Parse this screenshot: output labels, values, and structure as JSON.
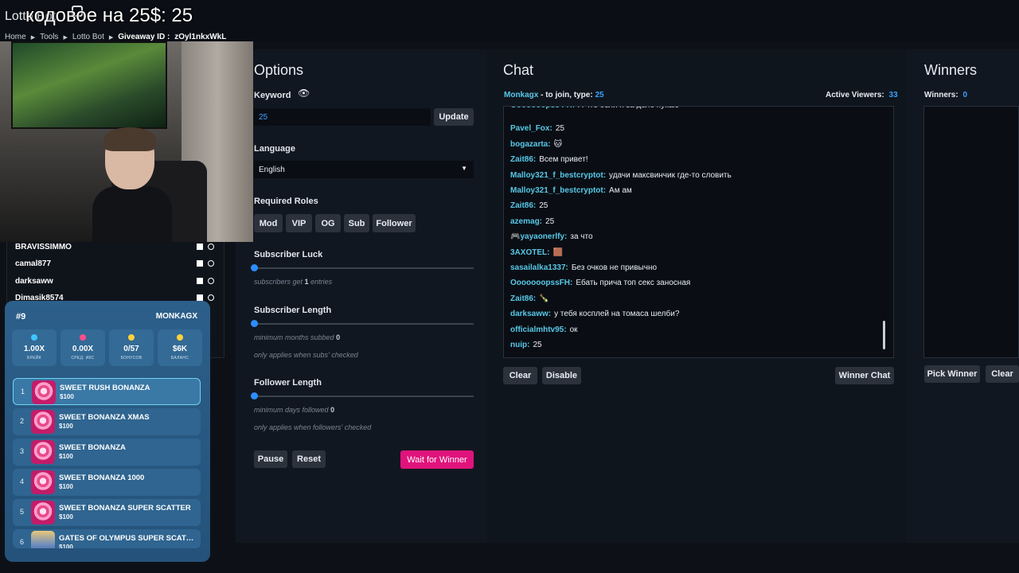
{
  "header": {
    "app_title": "Lotto Bot",
    "overlay_text": "кодовое на 25$: 25",
    "breadcrumb": [
      "Home",
      "Tools",
      "Lotto Bot"
    ],
    "giveaway_id_label": "Giveaway ID :",
    "giveaway_id": "zOyl1nkxWkL"
  },
  "options": {
    "title": "Options",
    "keyword_label": "Keyword",
    "keyword_value": "25",
    "update_label": "Update",
    "language_label": "Language",
    "language_value": "English",
    "roles_label": "Required Roles",
    "roles": [
      "Mod",
      "VIP",
      "OG",
      "Sub",
      "Follower"
    ],
    "sub_luck_label": "Subscriber Luck",
    "sub_luck_hint_pre": "subscribers get",
    "sub_luck_value": "1",
    "sub_luck_hint_post": "entries",
    "sub_length_label": "Subscriber Length",
    "sub_length_hint": "minimum months subbed",
    "sub_length_value": "0",
    "sub_length_note": "only applies when subs' checked",
    "follower_length_label": "Follower Length",
    "follower_length_hint": "minimum days followed",
    "follower_length_value": "0",
    "follower_length_note": "only applies when followers' checked",
    "pause_label": "Pause",
    "reset_label": "Reset",
    "wait_label": "Wait for Winner",
    "slider_levels": [
      0,
      0,
      0
    ]
  },
  "chat": {
    "title": "Chat",
    "join_user": "Monkagx",
    "join_text": " - to join, type: ",
    "join_keyword": "25",
    "active_label": "Active Viewers:",
    "active_count": "33",
    "messages": [
      {
        "user": "Ooooooopss FH:",
        "text": "А что если я за дело пукаю"
      },
      {
        "user": "Pavel_Fox:",
        "text": "25"
      },
      {
        "user": "bogazarta:",
        "text": "🐱"
      },
      {
        "user": "Zait86:",
        "text": "Всем привет!"
      },
      {
        "user": "Malloy321_f_bestcryptot:",
        "text": "удачи максвинчик где-то словить"
      },
      {
        "user": "Malloy321_f_bestcryptot:",
        "text": "Ам ам"
      },
      {
        "user": "Zait86:",
        "text": "25"
      },
      {
        "user": "azemag:",
        "text": "25"
      },
      {
        "user": "🎮yayaonerlfy:",
        "text": "за что"
      },
      {
        "user": "3AXOTEL:",
        "text": "🟫"
      },
      {
        "user": "sasailalka1337:",
        "text": "Без очков не привычно"
      },
      {
        "user": "OoooooopssFH:",
        "text": "Ебать прича топ секс заносная"
      },
      {
        "user": "Zait86:",
        "text": "🍾"
      },
      {
        "user": "darksaww:",
        "text": "у тебя косплей на томаса шелби?"
      },
      {
        "user": "officialmhtv95:",
        "text": "ок"
      },
      {
        "user": "nuip:",
        "text": "25"
      }
    ],
    "clear_label": "Clear",
    "disable_label": "Disable",
    "winner_chat_label": "Winner Chat"
  },
  "winners": {
    "title": "Winners",
    "count_label": "Winners:",
    "count": "0",
    "pick_label": "Pick Winner",
    "clear_label": "Clear"
  },
  "userlist": [
    "BRAVISSIMMO",
    "camal877",
    "darksaww",
    "Dimasik8574"
  ],
  "bonus": {
    "number": "#9",
    "user": "MONKAGX",
    "stats": [
      {
        "value": "1.00X",
        "label": "БРЕЙК",
        "color": "#3ec6ff"
      },
      {
        "value": "0.00X",
        "label": "СРЕД. ИКС",
        "color": "#ff4f8a"
      },
      {
        "value": "0/57",
        "label": "БОНУСОВ",
        "color": "#ffd23a"
      },
      {
        "value": "$6K",
        "label": "БАЛАНС",
        "color": "#ffd23a"
      }
    ],
    "slots": [
      {
        "idx": "1",
        "name": "SWEET RUSH BONANZA",
        "amount": "$100"
      },
      {
        "idx": "2",
        "name": "SWEET BONANZA XMAS",
        "amount": "$100"
      },
      {
        "idx": "3",
        "name": "SWEET BONANZA",
        "amount": "$100"
      },
      {
        "idx": "4",
        "name": "SWEET BONANZA 1000",
        "amount": "$100"
      },
      {
        "idx": "5",
        "name": "SWEET BONANZA SUPER SCATTER",
        "amount": "$100"
      },
      {
        "idx": "6",
        "name": "GATES OF OLYMPUS SUPER SCATTER",
        "amount": "$100"
      }
    ]
  },
  "colors": {
    "accent": "#2d8cff",
    "pink": "#e0137c",
    "chat_user": "#58c8e8"
  }
}
